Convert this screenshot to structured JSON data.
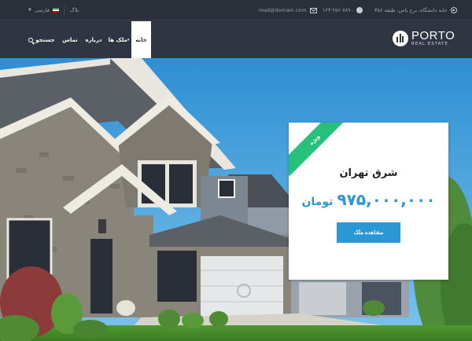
{
  "topbar": {
    "address": "خانه دانشگاه، برج یاس، طبقه ۳۵۶",
    "phone": "۱۲۳ ۴۵۶ ۷۸۹۰",
    "email": "mail@domain.com",
    "blog": "بلاگ",
    "language": "فارسی"
  },
  "header": {
    "logo_title": "PORTO",
    "logo_subtitle": "REAL ESTATE",
    "nav": {
      "home": "خانه",
      "properties": "ملک ها",
      "about": "درباره",
      "contact": "تماس",
      "search": "جستجو"
    }
  },
  "card": {
    "badge": "ویژه",
    "title": "شرق تهران",
    "price": "۹۷۵,۰۰۰,۰۰۰",
    "currency": "تومان",
    "button": "مشاهده ملک"
  },
  "colors": {
    "dark": "#2f3541",
    "accent_blue": "#2b98d6",
    "badge_green": "#27c07a"
  },
  "icons": [
    "location-icon",
    "phone-icon",
    "mail-icon",
    "flag-icon",
    "search-icon",
    "logo-icon"
  ]
}
